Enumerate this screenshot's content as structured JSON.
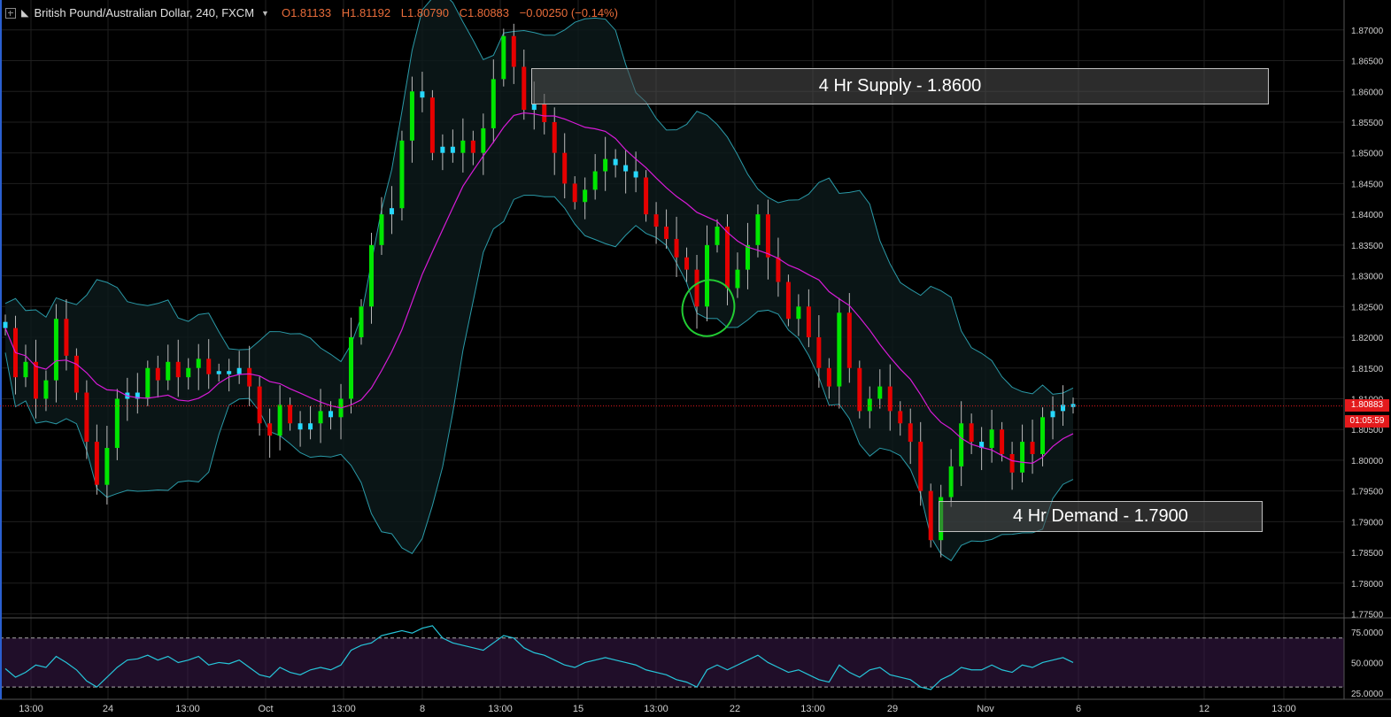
{
  "header": {
    "symbol": "British Pound/Australian Dollar, 240, FXCM",
    "open": "O1.81133",
    "high": "H1.81192",
    "low": "L1.80790",
    "close": "C1.80883",
    "change": "−0.00250 (−0.14%)"
  },
  "zones": {
    "supply_label": "4 Hr Supply - 1.8600",
    "demand_label": "4 Hr Demand - 1.7900"
  },
  "last_price": {
    "value": "1.80883",
    "countdown": "01:05:59"
  },
  "colors": {
    "background": "#000000",
    "up_candle": "#00e600",
    "down_candle": "#e60000",
    "doji_candle": "#26d9ff",
    "bollinger_band": "#2a9aa8",
    "moving_average": "#d81bd8",
    "rsi_line": "#26c6da",
    "rsi_band": "#3a1a4a",
    "circle": "#22cc33",
    "last_price_line": "#e31a1c"
  },
  "chart_data": [
    {
      "type": "candlestick",
      "title": "British Pound/Australian Dollar, 240, FXCM",
      "y_axis": {
        "ticks": [
          "1.77500",
          "1.78000",
          "1.78500",
          "1.79000",
          "1.79500",
          "1.80000",
          "1.80500",
          "1.81000",
          "1.81500",
          "1.82000",
          "1.82500",
          "1.83000",
          "1.83500",
          "1.84000",
          "1.84500",
          "1.85000",
          "1.85500",
          "1.86000",
          "1.86500",
          "1.87000"
        ],
        "range": [
          1.7745,
          1.8717
        ]
      },
      "x_axis": {
        "ticks": [
          "13:00",
          "24",
          "13:00",
          "Oct",
          "13:00",
          "8",
          "13:00",
          "15",
          "13:00",
          "22",
          "13:00",
          "29",
          "Nov",
          "6",
          "12",
          "13:00"
        ]
      },
      "price_path": [
        1.8215,
        1.8135,
        1.816,
        1.81,
        1.813,
        1.823,
        1.817,
        1.811,
        1.803,
        1.796,
        1.802,
        1.81,
        1.811,
        1.81,
        1.815,
        1.813,
        1.816,
        1.8135,
        1.815,
        1.8165,
        1.814,
        1.8145,
        1.814,
        1.815,
        1.812,
        1.806,
        1.804,
        1.809,
        1.806,
        1.805,
        1.806,
        1.808,
        1.807,
        1.81,
        1.82,
        1.825,
        1.835,
        1.84,
        1.841,
        1.852,
        1.86,
        1.859,
        1.85,
        1.851,
        1.85,
        1.852,
        1.85,
        1.854,
        1.862,
        1.869,
        1.864,
        1.857,
        1.858,
        1.855,
        1.85,
        1.845,
        1.842,
        1.844,
        1.847,
        1.849,
        1.848,
        1.847,
        1.846,
        1.84,
        1.838,
        1.836,
        1.833,
        1.831,
        1.825,
        1.835,
        1.838,
        1.828,
        1.831,
        1.835,
        1.84,
        1.833,
        1.829,
        1.823,
        1.825,
        1.82,
        1.815,
        1.812,
        1.824,
        1.815,
        1.808,
        1.81,
        1.812,
        1.808,
        1.806,
        1.803,
        1.795,
        1.787,
        1.794,
        1.799,
        1.806,
        1.803,
        1.802,
        1.805,
        1.801,
        1.798,
        1.803,
        1.801,
        1.807,
        1.808,
        1.809,
        1.8088
      ],
      "supply_level": 1.86,
      "demand_level": 1.79,
      "last_price": 1.80883
    },
    {
      "type": "line",
      "title": "RSI",
      "y_axis": {
        "ticks": [
          "25.0000",
          "50.0000",
          "75.0000"
        ],
        "range": [
          20,
          85
        ]
      },
      "overbought": 70,
      "oversold": 30,
      "values": [
        45,
        38,
        42,
        48,
        46,
        55,
        50,
        44,
        35,
        30,
        38,
        46,
        52,
        53,
        56,
        52,
        55,
        50,
        52,
        55,
        48,
        50,
        49,
        52,
        46,
        40,
        38,
        46,
        42,
        40,
        44,
        46,
        44,
        48,
        60,
        64,
        66,
        72,
        74,
        76,
        74,
        78,
        80,
        70,
        66,
        64,
        62,
        60,
        66,
        72,
        70,
        62,
        58,
        56,
        52,
        48,
        46,
        50,
        52,
        54,
        52,
        50,
        48,
        44,
        42,
        40,
        36,
        34,
        30,
        44,
        48,
        44,
        48,
        52,
        56,
        50,
        46,
        42,
        44,
        40,
        36,
        34,
        48,
        42,
        38,
        44,
        46,
        40,
        38,
        36,
        30,
        28,
        36,
        40,
        46,
        44,
        44,
        48,
        44,
        42,
        48,
        46,
        50,
        52,
        54,
        50
      ]
    }
  ]
}
